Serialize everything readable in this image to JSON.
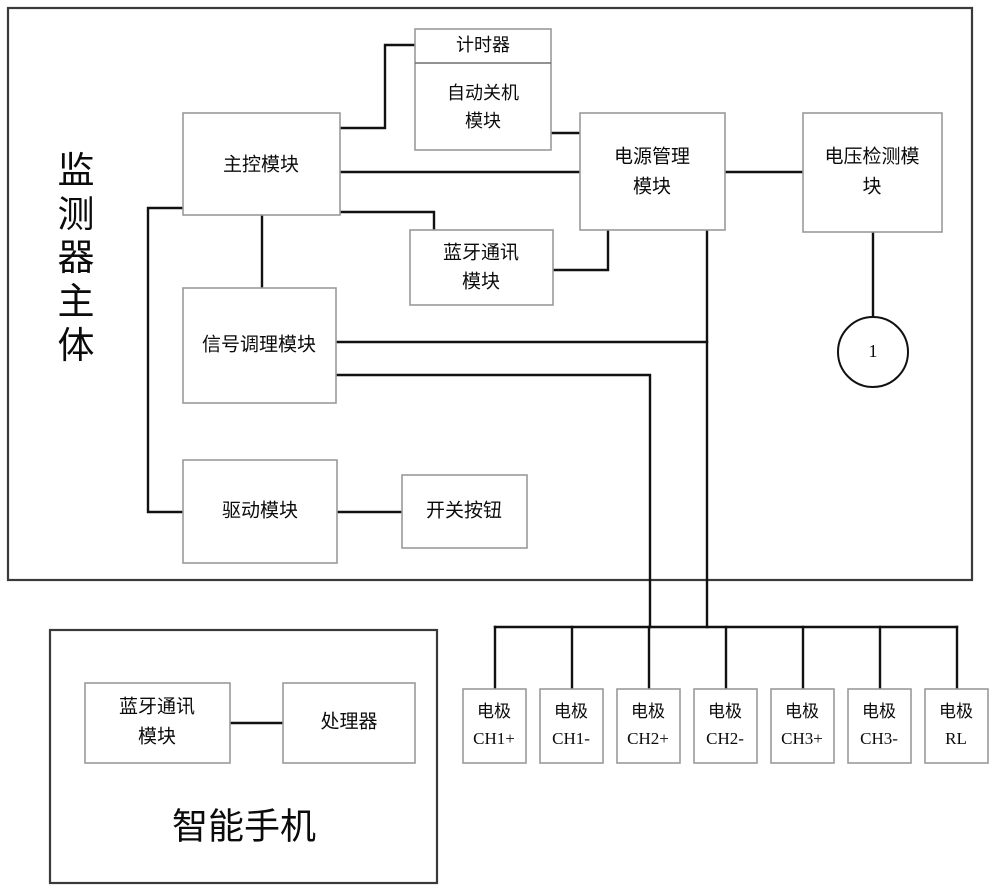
{
  "diagram": {
    "title_vertical": "监测器主体",
    "title_vertical_chars": [
      "监",
      "测",
      "器",
      "主",
      "体"
    ],
    "monitor_body_label": "监测器主体",
    "phone_label": "智能手机",
    "blocks": {
      "main_control": "主控模块",
      "timer": "计时器",
      "auto_shutdown": "自动关机\n模块",
      "auto_shutdown_line1": "自动关机",
      "auto_shutdown_line2": "模块",
      "power_management_line1": "电源管理",
      "power_management_line2": "模块",
      "voltage_detect_line1": "电压检测模",
      "voltage_detect_line2": "块",
      "bluetooth_line1": "蓝牙通讯",
      "bluetooth_line2": "模块",
      "signal_conditioning": "信号调理模块",
      "drive_module": "驱动模块",
      "switch_button": "开关按钮",
      "phone_bluetooth_line1": "蓝牙通讯",
      "phone_bluetooth_line2": "模块",
      "processor": "处理器"
    },
    "reference_marker": "1",
    "electrodes": [
      {
        "line1": "电极",
        "line2": "CH1+"
      },
      {
        "line1": "电极",
        "line2": "CH1-"
      },
      {
        "line1": "电极",
        "line2": "CH2+"
      },
      {
        "line1": "电极",
        "line2": "CH2-"
      },
      {
        "line1": "电极",
        "line2": "CH3+"
      },
      {
        "line1": "电极",
        "line2": "CH3-"
      },
      {
        "line1": "电极",
        "line2": "RL"
      }
    ],
    "colors": {
      "background": "#ffffff",
      "box_stroke": "#9a9a9a",
      "outer_stroke": "#3a3a3a",
      "connector": "#111111",
      "text": "#0b0b0b"
    }
  }
}
